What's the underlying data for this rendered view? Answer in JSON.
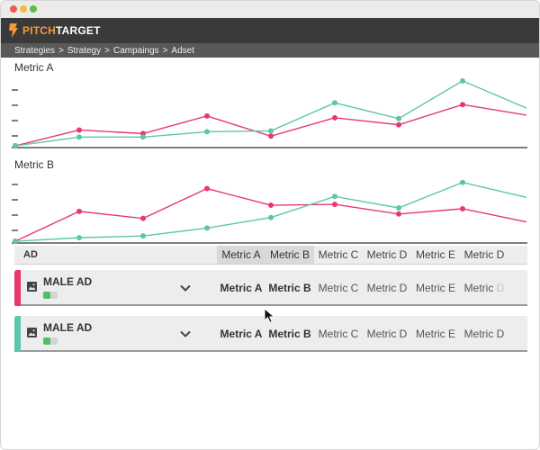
{
  "app": {
    "logo_prefix": "PITCH",
    "logo_suffix": "TARGET",
    "colors": {
      "appbar": "#3a3a3a",
      "accent_orange": "#f29a3a",
      "pink": "#e8386d",
      "teal": "#5cc6ad"
    }
  },
  "window": {
    "controls": [
      {
        "name": "close",
        "color": "#ed5b56"
      },
      {
        "name": "minimize",
        "color": "#f3bd3c"
      },
      {
        "name": "zoom",
        "color": "#5fbd4a"
      }
    ]
  },
  "breadcrumb": {
    "items": [
      "Strategies",
      "Strategy",
      "Campaings",
      "Adset"
    ],
    "separator": ">"
  },
  "charts": [
    {
      "title": "Metric A"
    },
    {
      "title": "Metric B"
    }
  ],
  "chart_data": [
    {
      "type": "line",
      "title": "Metric A",
      "x": [
        0,
        1,
        2,
        3,
        4,
        5,
        6,
        7,
        8
      ],
      "series": [
        {
          "color": "#e8386d",
          "values": [
            1,
            19,
            15,
            35,
            12,
            33,
            25,
            48,
            36
          ]
        },
        {
          "color": "#5cc6ad",
          "values": [
            1,
            11,
            11,
            17,
            18,
            50,
            32,
            75,
            44
          ]
        }
      ],
      "ylim": [
        0,
        80
      ],
      "grid": false
    },
    {
      "type": "line",
      "title": "Metric B",
      "x": [
        0,
        1,
        2,
        3,
        4,
        5,
        6,
        7,
        8
      ],
      "series": [
        {
          "color": "#e8386d",
          "values": [
            1,
            35,
            27,
            61,
            42,
            43,
            32,
            38,
            23
          ]
        },
        {
          "color": "#5cc6ad",
          "values": [
            1,
            5,
            7,
            16,
            28,
            52,
            39,
            68,
            51
          ]
        }
      ],
      "ylim": [
        0,
        80
      ],
      "grid": false
    }
  ],
  "table": {
    "header": {
      "ad_label": "AD",
      "metrics": [
        "Metric A",
        "Metric B",
        "Metric C",
        "Metric D",
        "Metric E",
        "Metric D"
      ],
      "selected": [
        "Metric A",
        "Metric B"
      ]
    },
    "rows": [
      {
        "name": "MALE AD",
        "stripe_color": "#e8386d",
        "metrics": [
          "Metric A",
          "Metric B",
          "Metric C",
          "Metric D",
          "Metric E",
          "Metric D"
        ],
        "last_visible": "Metric ",
        "last_faded": "D"
      },
      {
        "name": "MALE AD",
        "stripe_color": "#5cc6ad",
        "metrics": [
          "Metric A",
          "Metric B",
          "Metric C",
          "Metric D",
          "Metric E",
          "Metric D"
        ]
      }
    ]
  },
  "icons": {
    "ad_image": "image-icon",
    "expand": "chevron-down-icon",
    "toggle": "toggle-icon",
    "cursor": "mouse-cursor-icon",
    "logo": "pitchtarget-logo-icon"
  }
}
